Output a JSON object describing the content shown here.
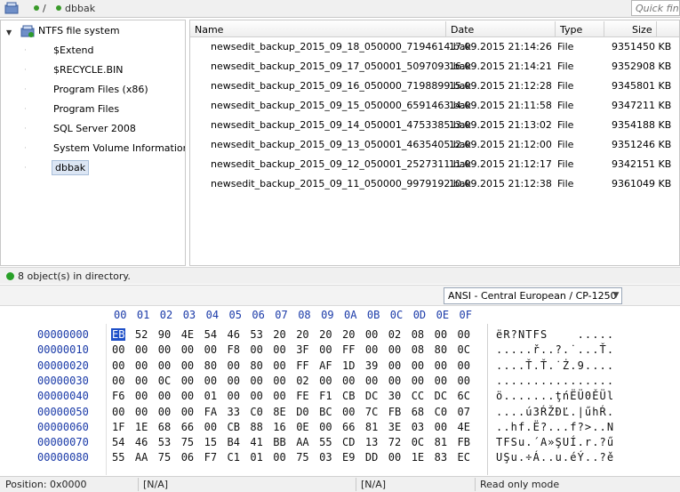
{
  "address": {
    "root": "/",
    "leaf": "dbbak",
    "quickfind_placeholder": "Quick find..."
  },
  "tree": {
    "root": "NTFS file system",
    "items": [
      {
        "label": "$Extend"
      },
      {
        "label": "$RECYCLE.BIN"
      },
      {
        "label": "Program Files (x86)"
      },
      {
        "label": "Program Files"
      },
      {
        "label": "SQL Server 2008"
      },
      {
        "label": "System Volume Information"
      },
      {
        "label": "dbbak",
        "selected": true
      }
    ]
  },
  "files": {
    "columns": [
      "Name",
      "Date",
      "Type",
      "Size"
    ],
    "rows": [
      {
        "name": "newsedit_backup_2015_09_18_050000_7194614.bak",
        "date": "17.09.2015 21:14:26",
        "type": "File",
        "size": "9351450 KB"
      },
      {
        "name": "newsedit_backup_2015_09_17_050001_5097093.bak",
        "date": "16.09.2015 21:14:21",
        "type": "File",
        "size": "9352908 KB"
      },
      {
        "name": "newsedit_backup_2015_09_16_050000_7198899.bak",
        "date": "15.09.2015 21:12:28",
        "type": "File",
        "size": "9345801 KB"
      },
      {
        "name": "newsedit_backup_2015_09_15_050000_6591463.bak",
        "date": "14.09.2015 21:11:58",
        "type": "File",
        "size": "9347211 KB"
      },
      {
        "name": "newsedit_backup_2015_09_14_050001_4753385.bak",
        "date": "13.09.2015 21:13:02",
        "type": "File",
        "size": "9354188 KB"
      },
      {
        "name": "newsedit_backup_2015_09_13_050001_4635405.bak",
        "date": "12.09.2015 21:12:00",
        "type": "File",
        "size": "9351246 KB"
      },
      {
        "name": "newsedit_backup_2015_09_12_050001_2527311.bak",
        "date": "11.09.2015 21:12:17",
        "type": "File",
        "size": "9342151 KB"
      },
      {
        "name": "newsedit_backup_2015_09_11_050000_9979192.bak",
        "date": "10.09.2015 21:12:38",
        "type": "File",
        "size": "9361049 KB"
      }
    ]
  },
  "status_dir": "8 object(s) in directory.",
  "toolbar": {
    "encoding": "ANSI - Central European / CP-1250",
    "icons": [
      "save-icon",
      "select-icon",
      "copy-icon",
      "paste-icon",
      "paste-special-icon",
      "find-icon",
      "back-icon",
      "forward-icon",
      "goto-icon",
      "bookmark-prev-icon",
      "bookmark-next-icon",
      "flag-icon",
      "bookmark-icon",
      "compare-icon",
      "compare-next-icon",
      "sync-icon",
      "edit-disabled-icon"
    ]
  },
  "hex": {
    "columns": [
      "00",
      "01",
      "02",
      "03",
      "04",
      "05",
      "06",
      "07",
      "08",
      "09",
      "0A",
      "0B",
      "0C",
      "0D",
      "0E",
      "0F"
    ],
    "cursor_index": 0,
    "rows": [
      {
        "offset": "00000000",
        "bytes": [
          "EB",
          "52",
          "90",
          "4E",
          "54",
          "46",
          "53",
          "20",
          "20",
          "20",
          "20",
          "00",
          "02",
          "08",
          "00",
          "00"
        ],
        "ascii": "ëR?NTFS    ....."
      },
      {
        "offset": "00000010",
        "bytes": [
          "00",
          "00",
          "00",
          "00",
          "00",
          "F8",
          "00",
          "00",
          "3F",
          "00",
          "FF",
          "00",
          "00",
          "08",
          "80",
          "0C"
        ],
        "ascii": ".....ř..?.˙...Ť."
      },
      {
        "offset": "00000020",
        "bytes": [
          "00",
          "00",
          "00",
          "00",
          "80",
          "00",
          "80",
          "00",
          "FF",
          "AF",
          "1D",
          "39",
          "00",
          "00",
          "00",
          "00"
        ],
        "ascii": "....Ť.Ť.˙Ż.9...."
      },
      {
        "offset": "00000030",
        "bytes": [
          "00",
          "00",
          "0C",
          "00",
          "00",
          "00",
          "00",
          "00",
          "02",
          "00",
          "00",
          "00",
          "00",
          "00",
          "00",
          "00"
        ],
        "ascii": "................"
      },
      {
        "offset": "00000040",
        "bytes": [
          "F6",
          "00",
          "00",
          "00",
          "01",
          "00",
          "00",
          "00",
          "FE",
          "F1",
          "CB",
          "DC",
          "30",
          "CC",
          "DC",
          "6C"
        ],
        "ascii": "ö.......ţńËÜ0ĚÜl"
      },
      {
        "offset": "00000050",
        "bytes": [
          "00",
          "00",
          "00",
          "00",
          "FA",
          "33",
          "C0",
          "8E",
          "D0",
          "BC",
          "00",
          "7C",
          "FB",
          "68",
          "C0",
          "07"
        ],
        "ascii": "....ú3ŔŽĐĽ.|űhŔ."
      },
      {
        "offset": "00000060",
        "bytes": [
          "1F",
          "1E",
          "68",
          "66",
          "00",
          "CB",
          "88",
          "16",
          "0E",
          "00",
          "66",
          "81",
          "3E",
          "03",
          "00",
          "4E"
        ],
        "ascii": "..hf.Ë?...f?>..N"
      },
      {
        "offset": "00000070",
        "bytes": [
          "54",
          "46",
          "53",
          "75",
          "15",
          "B4",
          "41",
          "BB",
          "AA",
          "55",
          "CD",
          "13",
          "72",
          "0C",
          "81",
          "FB"
        ],
        "ascii": "TFSu.´A»ŞUÍ.r.?ű"
      },
      {
        "offset": "00000080",
        "bytes": [
          "55",
          "AA",
          "75",
          "06",
          "F7",
          "C1",
          "01",
          "00",
          "75",
          "03",
          "E9",
          "DD",
          "00",
          "1E",
          "83",
          "EC"
        ],
        "ascii": "UŞu.÷Á..u.éÝ..?ě"
      }
    ]
  },
  "statusbar": {
    "position": "Position: 0x0000",
    "field2": "[N/A]",
    "field3": "[N/A]",
    "mode": "Read only mode"
  }
}
